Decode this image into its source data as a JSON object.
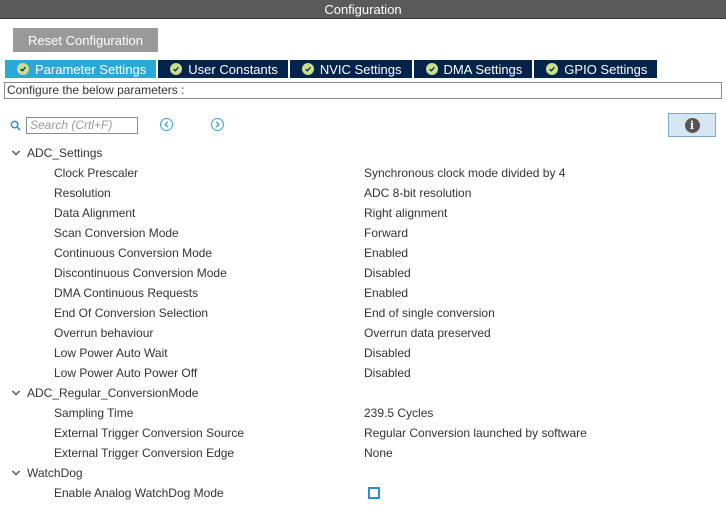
{
  "window": {
    "title": "Configuration"
  },
  "toolbar": {
    "reset_label": "Reset Configuration"
  },
  "tabs": [
    {
      "label": "Parameter Settings",
      "active": true
    },
    {
      "label": "User Constants",
      "active": false
    },
    {
      "label": "NVIC Settings",
      "active": false
    },
    {
      "label": "DMA Settings",
      "active": false
    },
    {
      "label": "GPIO Settings",
      "active": false
    }
  ],
  "configure_label": "Configure the below parameters :",
  "search": {
    "placeholder": "Search (Crtl+F)",
    "value": ""
  },
  "groups": [
    {
      "name": "ADC_Settings",
      "params": [
        {
          "name": "Clock Prescaler",
          "value": "Synchronous clock mode divided by 4"
        },
        {
          "name": "Resolution",
          "value": "ADC 8-bit resolution"
        },
        {
          "name": "Data Alignment",
          "value": "Right alignment"
        },
        {
          "name": "Scan Conversion Mode",
          "value": "Forward"
        },
        {
          "name": "Continuous Conversion Mode",
          "value": "Enabled"
        },
        {
          "name": "Discontinuous Conversion Mode",
          "value": "Disabled"
        },
        {
          "name": "DMA Continuous Requests",
          "value": "Enabled"
        },
        {
          "name": "End Of Conversion Selection",
          "value": "End of single conversion"
        },
        {
          "name": "Overrun behaviour",
          "value": "Overrun data preserved"
        },
        {
          "name": "Low Power Auto Wait",
          "value": "Disabled"
        },
        {
          "name": "Low Power Auto Power Off",
          "value": "Disabled"
        }
      ]
    },
    {
      "name": "ADC_Regular_ConversionMode",
      "params": [
        {
          "name": "Sampling Time",
          "value": "239.5 Cycles"
        },
        {
          "name": "External Trigger Conversion Source",
          "value": "Regular Conversion launched by software"
        },
        {
          "name": "External Trigger Conversion Edge",
          "value": "None"
        }
      ]
    },
    {
      "name": "WatchDog",
      "params": [
        {
          "name": "Enable Analog WatchDog Mode",
          "checkbox": true,
          "checked": false
        }
      ]
    }
  ],
  "colors": {
    "titlebar": "#5a5a5a",
    "tab_active": "#2aa8d6",
    "tab_inactive": "#03234b",
    "check": "#c8e08c",
    "accent": "#2aa8d6"
  },
  "icons": {
    "search": "search-icon",
    "prev": "chevron-left-icon",
    "next": "chevron-right-icon",
    "info": "info-icon",
    "expand": "chevron-down-icon",
    "tab_check": "check-icon"
  }
}
